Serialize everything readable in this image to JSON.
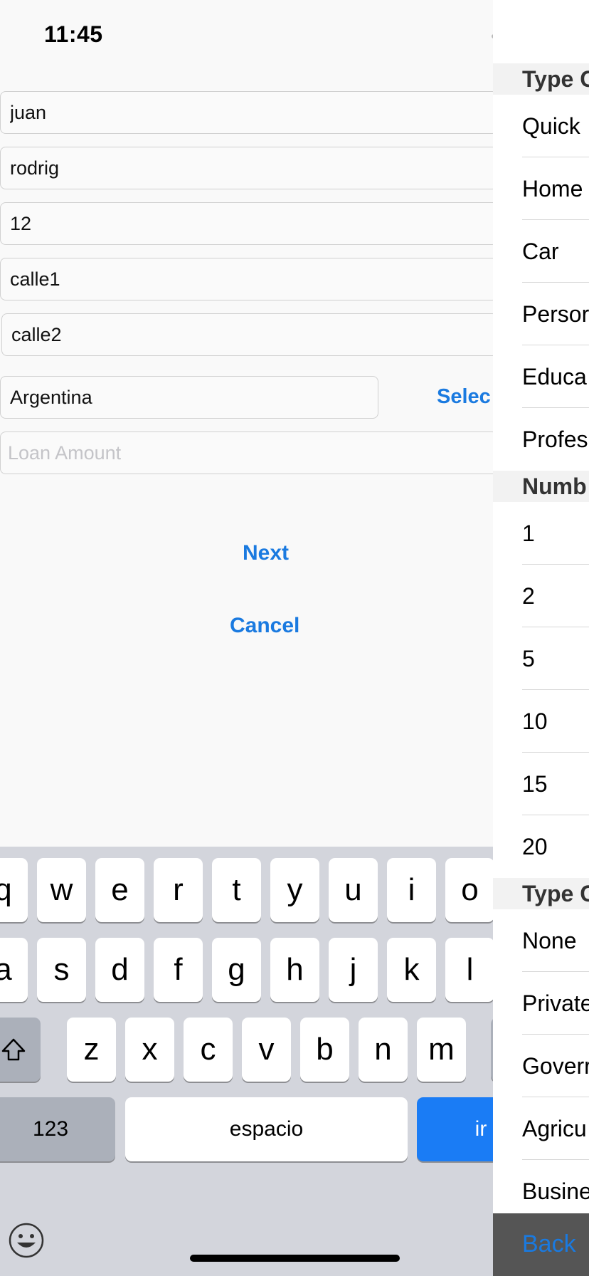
{
  "status_bar": {
    "time": "11:45"
  },
  "form": {
    "first_name": "juan",
    "last_name": "rodrig",
    "age": "12",
    "address1": "calle1",
    "address2": "calle2",
    "country": "Argentina",
    "select_label": "Selec",
    "loan_amount_placeholder": "Loan Amount",
    "next_label": "Next",
    "cancel_label": "Cancel"
  },
  "keyboard": {
    "row1": [
      "q",
      "w",
      "e",
      "r",
      "t",
      "y",
      "u",
      "i",
      "o"
    ],
    "row2": [
      "a",
      "s",
      "d",
      "f",
      "g",
      "h",
      "j",
      "k",
      "l"
    ],
    "row3": [
      "z",
      "x",
      "c",
      "v",
      "b",
      "n",
      "m"
    ],
    "numbers_label": "123",
    "space_label": "espacio",
    "go_label": "ir"
  },
  "side_panel": {
    "section1_header": "Type C",
    "section1_items": [
      "Quick",
      "Home",
      "Car",
      "Persor",
      "Educa",
      "Profes"
    ],
    "section2_header": "Numb",
    "section2_items": [
      "1",
      "2",
      "5",
      "10",
      "15",
      "20"
    ],
    "section3_header": "Type C",
    "section3_items": [
      "None",
      "Private",
      "Goverr",
      "Agricu",
      "Busine"
    ],
    "back_label": "Back"
  }
}
